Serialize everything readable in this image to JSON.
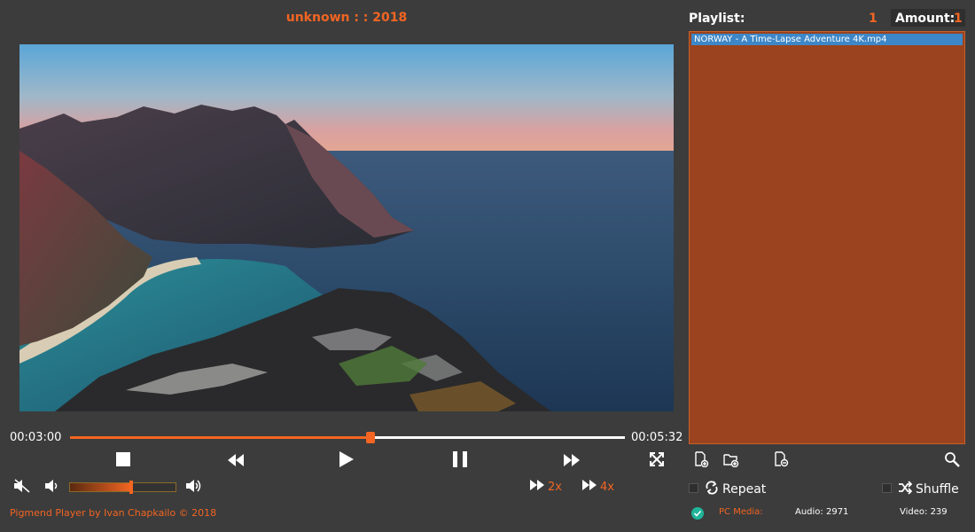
{
  "window": {
    "title": "unknown : : 2018"
  },
  "video": {
    "description_icon": "video-frame"
  },
  "seek": {
    "current_time": "00:03:00",
    "total_time": "00:05:32",
    "progress": 0.542
  },
  "controls": {
    "stop_icon": "stop-icon",
    "rewind_icon": "rewind-icon",
    "play_icon": "play-icon",
    "pause_icon": "pause-icon",
    "forward_icon": "fast-forward-icon",
    "fullscreen_icon": "fullscreen-icon"
  },
  "volume": {
    "level": 0.58,
    "mute_icon": "mute-icon",
    "down_icon": "volume-down-icon",
    "up_icon": "volume-up-icon"
  },
  "speed": {
    "x2_label": "2x",
    "x4_label": "4x"
  },
  "footer": {
    "credit": "Pigmend Player by Ivan Chapkailo © 2018"
  },
  "playlist": {
    "label": "Playlist:",
    "current_index": "1",
    "amount_label": "Amount:",
    "amount_value": "1",
    "items": [
      "NORWAY - A Time-Lapse Adventure 4K.mp4"
    ]
  },
  "playlist_toolbar": {
    "add_file_icon": "add-file-icon",
    "add_folder_icon": "add-folder-icon",
    "remove_icon": "remove-file-icon",
    "search_icon": "search-icon"
  },
  "options": {
    "repeat_label": "Repeat",
    "shuffle_label": "Shuffle"
  },
  "status": {
    "pc_media_label": "PC Media:",
    "audio": "Audio: 2971",
    "video": "Video: 239"
  },
  "colors": {
    "accent": "#f26522",
    "background": "#3c3c3c",
    "playlist_bg": "#9b431e",
    "selected_item": "#3d87c8"
  }
}
